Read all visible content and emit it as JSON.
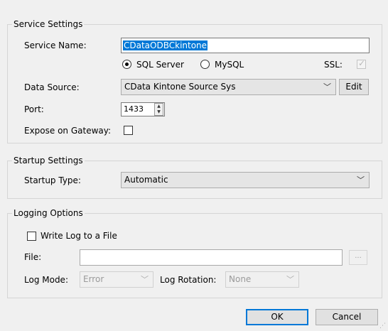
{
  "service_settings": {
    "title": "Service Settings",
    "service_name_label": "Service Name:",
    "service_name_value": "CDataODBCkintone",
    "sql_server_label": "SQL Server",
    "mysql_label": "MySQL",
    "ssl_label": "SSL:",
    "data_source_label": "Data Source:",
    "data_source_value": "CData Kintone Source Sys",
    "edit_button": "Edit",
    "port_label": "Port:",
    "port_value": "1433",
    "expose_label": "Expose on Gateway:"
  },
  "startup_settings": {
    "title": "Startup Settings",
    "startup_type_label": "Startup Type:",
    "startup_type_value": "Automatic"
  },
  "logging_options": {
    "title": "Logging Options",
    "write_log_label": "Write Log to a File",
    "file_label": "File:",
    "browse_button": "...",
    "log_mode_label": "Log Mode:",
    "log_mode_value": "Error",
    "log_rotation_label": "Log Rotation:",
    "log_rotation_value": "None"
  },
  "footer": {
    "ok_button": "OK",
    "cancel_button": "Cancel"
  },
  "icons": {
    "dropdown": "chevron-down-icon",
    "spin_up": "triangle-up-icon",
    "spin_down": "triangle-down-icon",
    "check": "checkmark-icon"
  },
  "colors": {
    "accent": "#0078d7",
    "selection": "#0078d7",
    "background": "#f0f0f0"
  }
}
